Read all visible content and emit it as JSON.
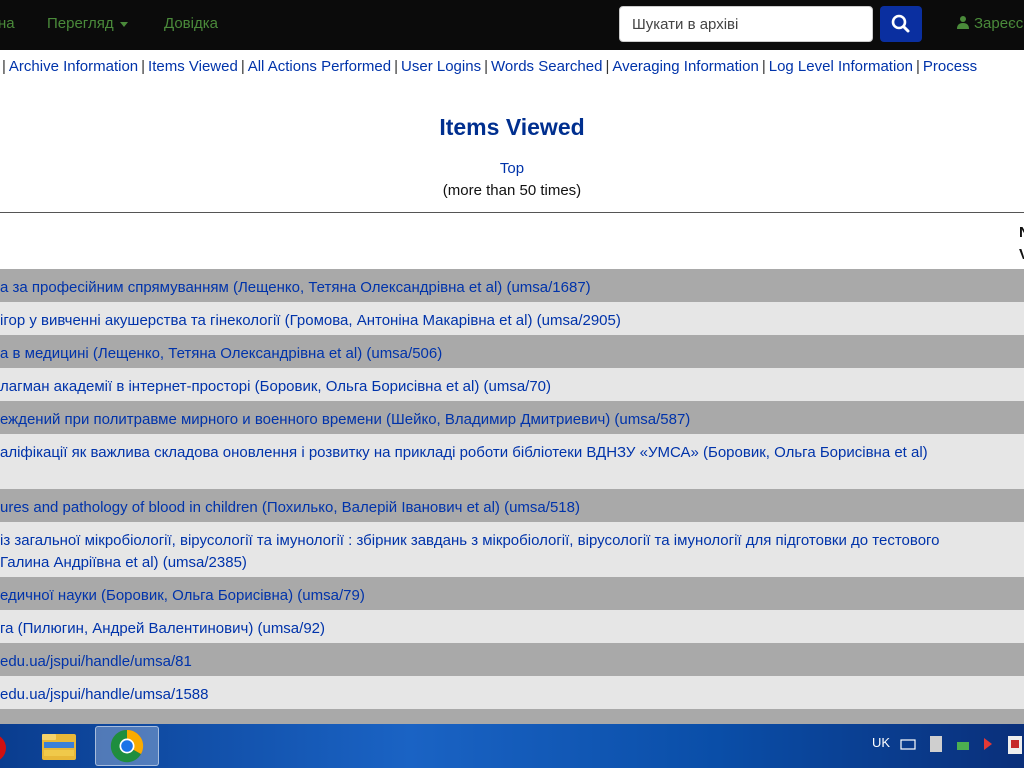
{
  "navbar": {
    "partial_left": "на",
    "browse": "Перегляд",
    "help": "Довідка",
    "search_placeholder": "Шукати в архіві",
    "user": "Зареєс"
  },
  "menu": {
    "items": [
      "Archive Information",
      "Items Viewed",
      "All Actions Performed",
      "User Logins",
      "Words Searched",
      "Averaging Information",
      "Log Level Information",
      "Process"
    ]
  },
  "page": {
    "title": "Items Viewed",
    "top_link": "Top",
    "subtitle": "(more than 50 times)",
    "col_header": "N\nV"
  },
  "rows": [
    {
      "line1": "а за професійним спрямуванням (Лещенко, Тетяна Олександрівна et al) (umsa/1687)",
      "line2": ""
    },
    {
      "line1": "ігор у вивченні акушерства та гінекології (Громова, Антоніна Макарівна et al) (umsa/2905)",
      "line2": ""
    },
    {
      "line1": "а в медицині (Лещенко, Тетяна Олександрівна et al) (umsa/506)",
      "line2": ""
    },
    {
      "line1": "лагман академії в інтернет-просторі (Боровик, Ольга Борисівна et al) (umsa/70)",
      "line2": ""
    },
    {
      "line1": "еждений при политравме мирного и военного времени (Шейко, Владимир Дмитриевич) (umsa/587)",
      "line2": ""
    },
    {
      "line1": "аліфікації як важлива складова оновлення і розвитку на прикладі роботи бібліотеки ВДНЗУ «УМСА» (Боровик, Ольга Борисівна et al)",
      "line2": " "
    },
    {
      "line1": "ures and pathology of blood in children (Похилько, Валерій Іванович et al) (umsa/518)",
      "line2": ""
    },
    {
      "line1": " із загальної мікробіології, вірусології та імунології : збірник завдань з мікробіології, вірусології та імунології для підготовки до тестового",
      "line2": " Галина Андріївна et al) (umsa/2385)"
    },
    {
      "line1": "едичної науки (Боровик, Ольга Борисівна) (umsa/79)",
      "line2": ""
    },
    {
      "line1": "га (Пилюгин, Андрей Валентинович) (umsa/92)",
      "line2": ""
    },
    {
      "line1": "edu.ua/jspui/handle/umsa/81",
      "line2": ""
    },
    {
      "line1": "edu.ua/jspui/handle/umsa/1588",
      "line2": ""
    },
    {
      "line1": "",
      "line2": ""
    }
  ],
  "taskbar": {
    "lang": "UK"
  }
}
